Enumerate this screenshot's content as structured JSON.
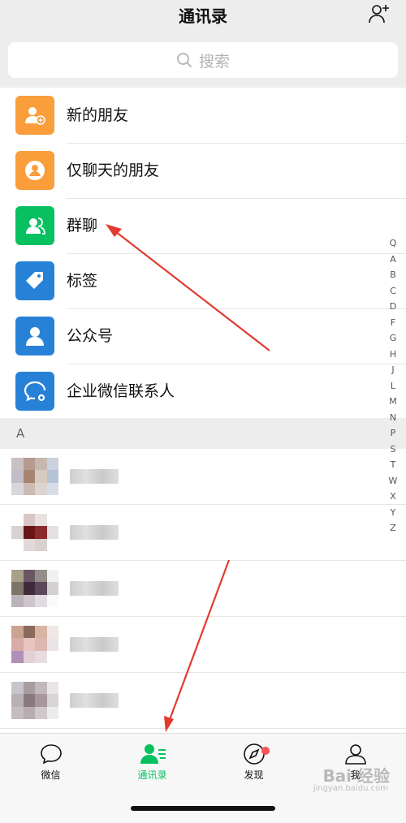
{
  "header": {
    "title": "通讯录",
    "add_icon": "add-contact-icon"
  },
  "search": {
    "placeholder": "搜索"
  },
  "menu": [
    {
      "label": "新的朋友",
      "icon": "new-friend-icon",
      "color": "#fa9d3b"
    },
    {
      "label": "仅聊天的朋友",
      "icon": "chat-only-friend-icon",
      "color": "#fa9d3b"
    },
    {
      "label": "群聊",
      "icon": "group-chat-icon",
      "color": "#07c160"
    },
    {
      "label": "标签",
      "icon": "tag-icon",
      "color": "#2782d7"
    },
    {
      "label": "公众号",
      "icon": "official-account-icon",
      "color": "#2782d7"
    },
    {
      "label": "企业微信联系人",
      "icon": "wecom-contact-icon",
      "color": "#2782d7"
    }
  ],
  "section": {
    "letter": "A"
  },
  "index_letters": [
    "Q",
    "A",
    "B",
    "C",
    "D",
    "F",
    "G",
    "H",
    "J",
    "L",
    "M",
    "N",
    "P",
    "S",
    "T",
    "W",
    "X",
    "Y",
    "Z"
  ],
  "tabs": [
    {
      "label": "微信",
      "icon": "chat-bubble-icon",
      "active": false
    },
    {
      "label": "通讯录",
      "icon": "contacts-icon",
      "active": true
    },
    {
      "label": "发现",
      "icon": "compass-icon",
      "active": false,
      "badge": true
    },
    {
      "label": "我",
      "icon": "person-icon",
      "active": false
    }
  ],
  "watermark": {
    "text": "Bai 经验",
    "sub": "jingyan.baidu.com"
  },
  "colors": {
    "accent": "#07c160",
    "orange": "#fa9d3b",
    "blue": "#2782d7",
    "badge": "#fa5151",
    "arrow": "#e23b2e"
  }
}
